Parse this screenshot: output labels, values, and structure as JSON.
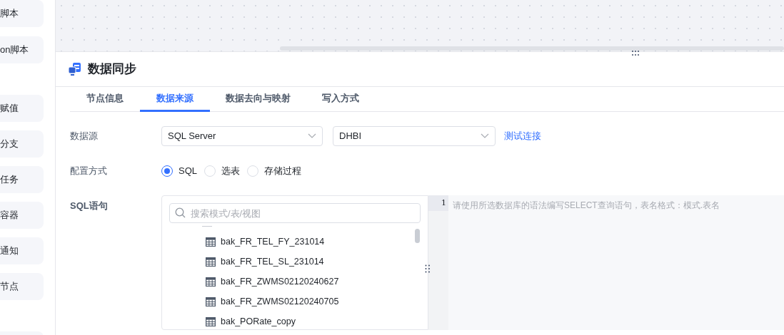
{
  "sidebar": {
    "items": [
      {
        "label": "脚本"
      },
      {
        "label": "on脚本"
      },
      {
        "label": "赋值"
      },
      {
        "label": "分支"
      },
      {
        "label": "任务"
      },
      {
        "label": "容器"
      },
      {
        "label": "通知"
      },
      {
        "label": "节点"
      }
    ]
  },
  "panel": {
    "title": "数据同步",
    "tabs": [
      {
        "label": "节点信息",
        "selected": false
      },
      {
        "label": "数据来源",
        "selected": true
      },
      {
        "label": "数据去向与映射",
        "selected": false
      },
      {
        "label": "写入方式",
        "selected": false
      }
    ],
    "form": {
      "source_label": "数据源",
      "source_type": "SQL Server",
      "source_db": "DHBI",
      "test_link": "测试连接",
      "mode_label": "配置方式",
      "modes": [
        {
          "label": "SQL",
          "selected": true
        },
        {
          "label": "选表",
          "selected": false
        },
        {
          "label": "存储过程",
          "selected": false
        }
      ],
      "sql_label": "SQL语句",
      "tree": {
        "search_placeholder": "搜索模式/表/视图",
        "items": [
          {
            "label": "bak_FR_TEL_FY_231014"
          },
          {
            "label": "bak_FR_TEL_SL_231014"
          },
          {
            "label": "bak_FR_ZWMS02120240627"
          },
          {
            "label": "bak_FR_ZWMS02120240705"
          },
          {
            "label": "bak_PORate_copy"
          }
        ]
      },
      "editor": {
        "line_number": "1",
        "placeholder": "请使用所选数据库的语法编写SELECT查询语句，表名格式：模式.表名"
      }
    }
  }
}
